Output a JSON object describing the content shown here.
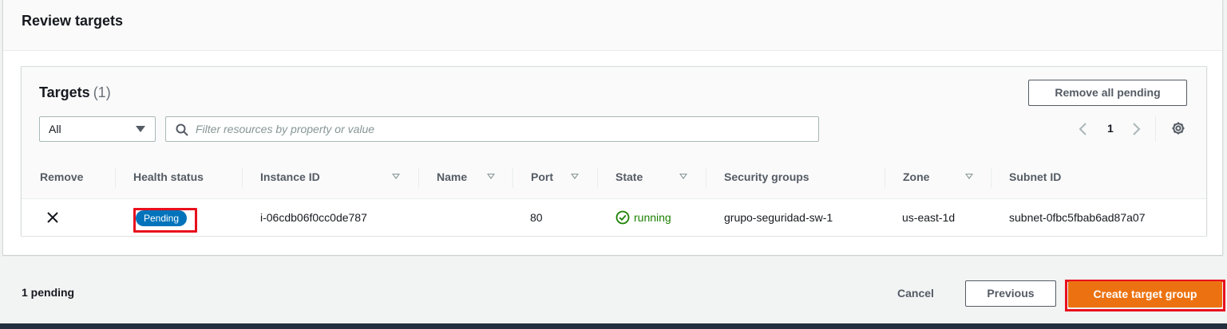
{
  "review": {
    "title": "Review targets"
  },
  "targets": {
    "title": "Targets",
    "count": "(1)",
    "remove_all_label": "Remove all pending",
    "filter_select_value": "All",
    "filter_placeholder": "Filter resources by property or value",
    "page_number": "1"
  },
  "table": {
    "headers": {
      "remove": "Remove",
      "health": "Health status",
      "instance_id": "Instance ID",
      "name": "Name",
      "port": "Port",
      "state": "State",
      "security_groups": "Security groups",
      "zone": "Zone",
      "subnet_id": "Subnet ID"
    },
    "rows": [
      {
        "health_status": "Pending",
        "instance_id": "i-06cdb06f0cc0de787",
        "name": "",
        "port": "80",
        "state": "running",
        "security_groups": "grupo-seguridad-sw-1",
        "zone": "us-east-1d",
        "subnet_id": "subnet-0fbc5fbab6ad87a07"
      }
    ]
  },
  "footer": {
    "pending_count": "1 pending",
    "cancel_label": "Cancel",
    "previous_label": "Previous",
    "create_label": "Create target group"
  },
  "colors": {
    "primary_button": "#ec7211",
    "pending_badge": "#0073bb",
    "running_status": "#1d8102",
    "highlight_annotation": "#e8101d"
  },
  "icons": {
    "filter_search": "search-icon",
    "pager_prev": "chevron-left-icon",
    "pager_next": "chevron-right-icon",
    "preferences": "gear-icon",
    "remove_row": "close-icon",
    "state_ok": "check-circle-icon"
  }
}
